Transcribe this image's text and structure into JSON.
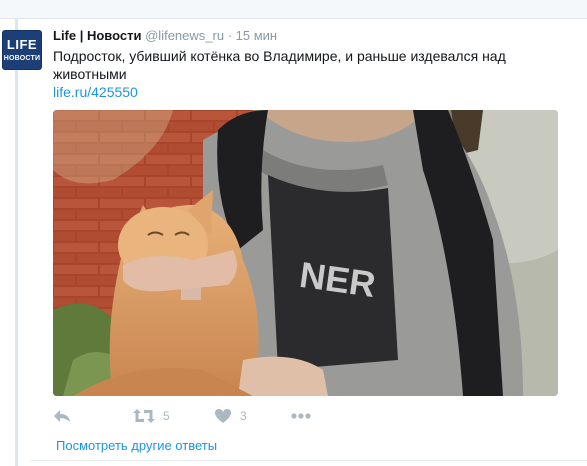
{
  "tweet": {
    "avatar": {
      "line1": "LIFE",
      "line2": "НОВОСТИ",
      "bg": "#1c3f78"
    },
    "name": "Life | Новости",
    "handle": "@lifenews_ru",
    "separator": "·",
    "time": "15 мин",
    "text": "Подросток, убивший котёнка во Владимире, и раньше издевался над животными",
    "link": "life.ru/425550",
    "image_icon": "photo-teen-holding-ginger-cat"
  },
  "actions": {
    "reply_icon": "reply-icon",
    "retweet_icon": "retweet-icon",
    "retweet_count": "5",
    "like_icon": "heart-icon",
    "like_count": "3",
    "more_icon": "more-icon"
  },
  "footer": {
    "more_replies": "Посмотреть другие ответы"
  },
  "colors": {
    "link": "#1b95e0",
    "muted": "#8899a6",
    "icon": "#aab8c2"
  }
}
